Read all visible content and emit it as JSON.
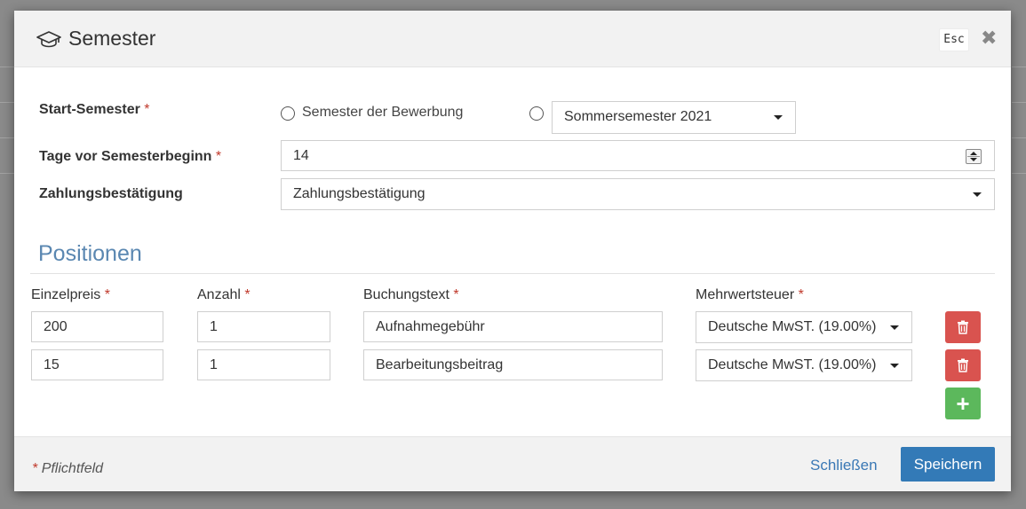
{
  "modal": {
    "title": "Semester",
    "esc_label": "Esc",
    "close_glyph": "✖"
  },
  "form": {
    "start_semester": {
      "label": "Start-Semester",
      "required": "*",
      "option_1_label": "Semester der Bewerbung",
      "option_2_select_value": "Sommersemester 2021"
    },
    "days_before": {
      "label": "Tage vor Semesterbeginn",
      "required": "*",
      "value": "14"
    },
    "payment_confirmation": {
      "label": "Zahlungsbestätigung",
      "select_value": "Zahlungsbestätigung"
    }
  },
  "positions": {
    "title": "Positionen",
    "columns": {
      "unit_price": "Einzelpreis",
      "quantity": "Anzahl",
      "booking_text": "Buchungstext",
      "vat": "Mehrwertsteuer",
      "required": "*"
    },
    "rows": [
      {
        "unit_price": "200",
        "quantity": "1",
        "booking_text": "Aufnahmegebühr",
        "vat": "Deutsche MwST. (19.00%)"
      },
      {
        "unit_price": "15",
        "quantity": "1",
        "booking_text": "Bearbeitungsbeitrag",
        "vat": "Deutsche MwST. (19.00%)"
      }
    ],
    "add_glyph": "+"
  },
  "footer": {
    "required_mark": "*",
    "required_note": "Pflichtfeld",
    "close_label": "Schließen",
    "save_label": "Speichern"
  },
  "colors": {
    "primary": "#337ab7",
    "danger": "#d9534f",
    "success": "#5cb85c",
    "section_title": "#5a87b1",
    "required": "#c0392b"
  },
  "icons": {
    "title_icon": "graduation-cap-icon",
    "delete_icon": "trash-icon",
    "add_icon": "plus-icon"
  }
}
